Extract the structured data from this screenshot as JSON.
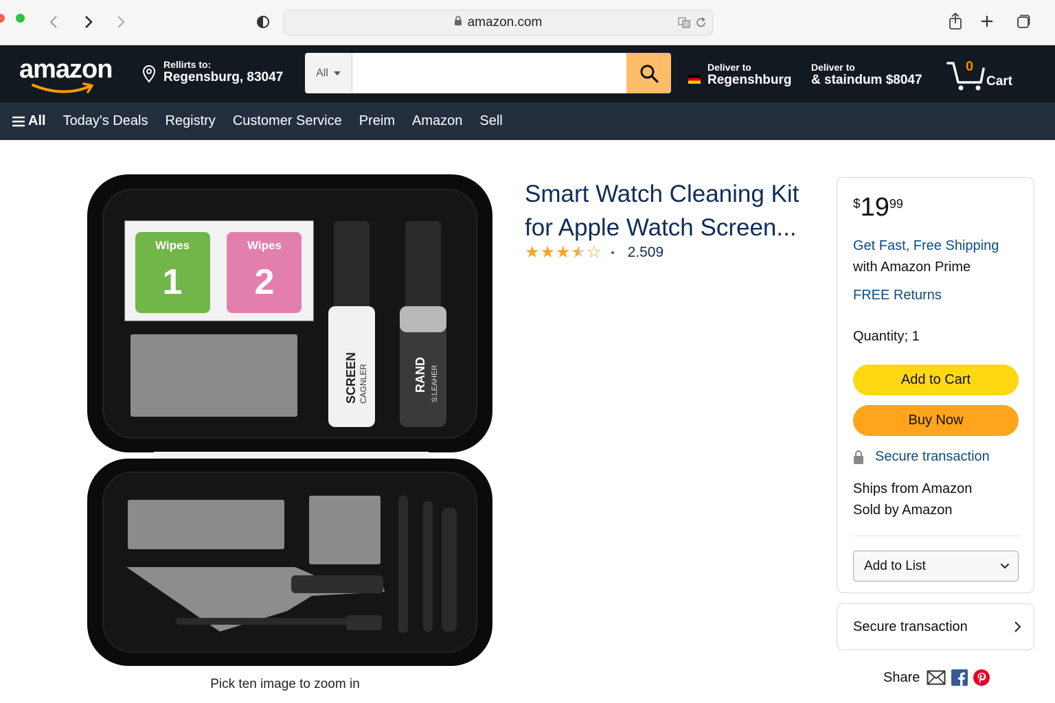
{
  "browser": {
    "url": "amazon.com"
  },
  "header": {
    "logo_text": "amazon",
    "location_line1": "Rellirts to:",
    "location_line2": "Regensburg, 83047",
    "search_category": "All",
    "search_placeholder": "",
    "deliver1_line1": "Deliver to",
    "deliver1_line2": "Regenshburg",
    "deliver2_line1": "Deliver to",
    "deliver2_line2": "& staindum $8047",
    "cart_count": "0",
    "cart_label": "Cart"
  },
  "nav": {
    "all_label": "All",
    "items": [
      "Today's Deals",
      "Registry",
      "Customer Service",
      "Preim",
      "Amazon",
      "Sell"
    ]
  },
  "product": {
    "title": "Smart Watch Cleaning Kit for Apple Watch Screen...",
    "rating": 3.5,
    "rating_count": "2.509",
    "zoom_hint": "Pick ten image to zoom in",
    "image_labels": {
      "wipes1_label": "Wipes",
      "wipes1_number": "1",
      "wipes2_label": "Wipes",
      "wipes2_number": "2",
      "bottle1_line1": "SCREEN",
      "bottle1_line2": "CAGNLER",
      "bottle2_line1": "RAND",
      "bottle2_line2": "S:LEAHER"
    }
  },
  "buybox": {
    "price_symbol": "$",
    "price_whole": "19",
    "price_fraction": "99",
    "shipping_line1": "Get Fast, Free Shipping",
    "shipping_line2": "with Amazon Prime",
    "returns": "FREE Returns",
    "quantity": "Quantity; 1",
    "add_to_cart": "Add to Cart",
    "buy_now": "Buy Now",
    "secure_transaction": "Secure transaction",
    "ships_from": "Ships from Amazon",
    "sold_by": "Sold by Amazon",
    "add_to_list": "Add to List"
  },
  "secure_box": {
    "label": "Secure transaction"
  },
  "share": {
    "label": "Share"
  },
  "colors": {
    "topbar": "#131921",
    "navbar": "#232f3e",
    "search_button": "#febd69",
    "add_to_cart": "#ffd814",
    "buy_now": "#ffa41c",
    "link_blue": "#0f4c81",
    "star": "#f5a623"
  }
}
